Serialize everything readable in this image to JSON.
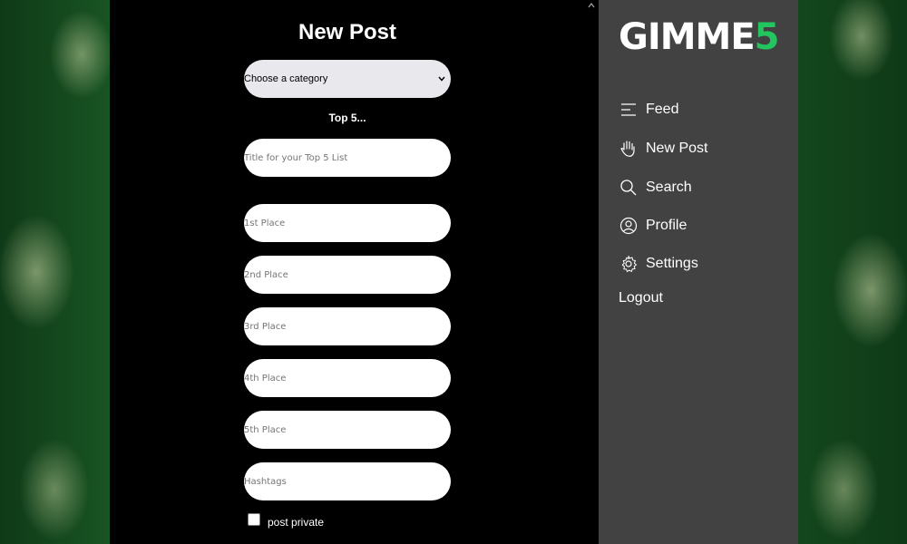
{
  "page": {
    "title": "New Post",
    "category_select": {
      "value": "Choose a category"
    },
    "top5_label": "Top 5...",
    "fields": {
      "title_placeholder": "Title for your Top 5 List",
      "place1_placeholder": "1st Place",
      "place2_placeholder": "2nd Place",
      "place3_placeholder": "3rd Place",
      "place4_placeholder": "4th Place",
      "place5_placeholder": "5th Place",
      "hashtags_placeholder": "Hashtags"
    },
    "private_label": "post private"
  },
  "sidebar": {
    "logo_main": "GIMME",
    "logo_accent": "5",
    "items": [
      {
        "label": "Feed",
        "icon": "feed-lines-icon"
      },
      {
        "label": "New Post",
        "icon": "hand-icon"
      },
      {
        "label": "Search",
        "icon": "search-icon"
      },
      {
        "label": "Profile",
        "icon": "profile-icon"
      },
      {
        "label": "Settings",
        "icon": "gear-icon"
      }
    ],
    "logout_label": "Logout"
  },
  "colors": {
    "accent": "#22c55e",
    "sidebar_bg": "#424242",
    "main_bg": "#000000"
  }
}
